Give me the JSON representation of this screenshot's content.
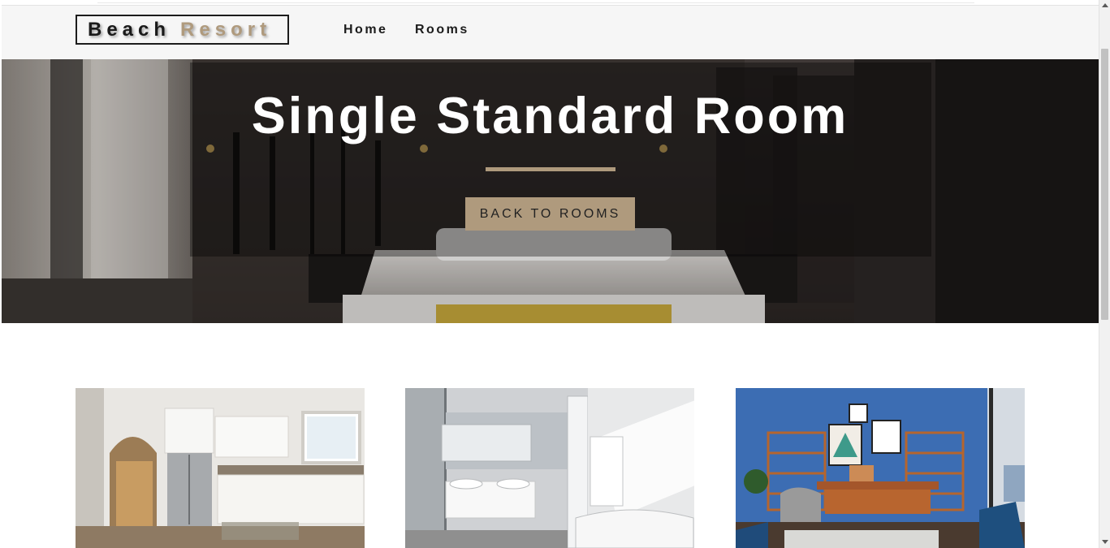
{
  "navbar": {
    "logo_word1": "Beach",
    "logo_word2": "Resort",
    "links": [
      {
        "label": "Home"
      },
      {
        "label": "Rooms"
      }
    ]
  },
  "hero": {
    "title": "Single Standard Room",
    "button_label": "BACK TO ROOMS"
  },
  "gallery": [
    {
      "subject": "kitchen"
    },
    {
      "subject": "bathroom"
    },
    {
      "subject": "study room"
    }
  ],
  "colors": {
    "accent": "#af9a7d",
    "navbar_bg": "#f6f6f6",
    "text_dark": "#1c1c1c"
  }
}
